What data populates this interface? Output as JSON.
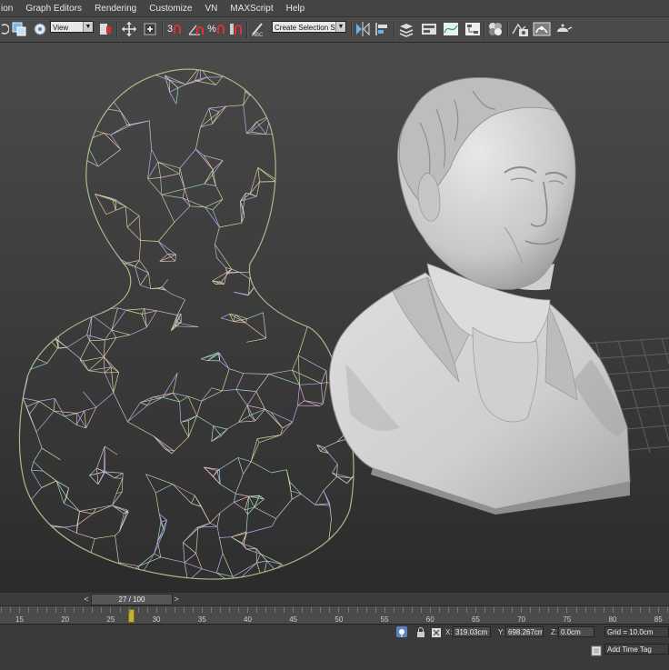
{
  "menu": {
    "items": [
      "ion",
      "Graph Editors",
      "Rendering",
      "Customize",
      "VN",
      "MAXScript",
      "Help"
    ]
  },
  "toolbar": {
    "view_select": "View",
    "selection_set": "Create Selection Se",
    "snap_label": "3",
    "percent_label": "%"
  },
  "timeslider": {
    "frame_display": "27 / 100",
    "prev": "<",
    "next": ">"
  },
  "track": {
    "frames": [
      "15",
      "20",
      "25",
      "30",
      "35",
      "40",
      "45",
      "50",
      "55",
      "60",
      "65",
      "70",
      "75",
      "80",
      "85"
    ],
    "current_frame": 27
  },
  "status": {
    "x_label": "X:",
    "x_value": "319.03cm",
    "y_label": "Y:",
    "y_value": "698.267cm",
    "z_label": "Z:",
    "z_value": "0.0cm",
    "grid": "Grid = 10.0cm",
    "add_time_tag": "Add Time Tag"
  },
  "colors": {
    "viewport_top": "#4a4a4a",
    "viewport_bottom": "#2a2a2a",
    "bust_surface": "#d6d6d6",
    "key_marker": "#c8b030"
  }
}
